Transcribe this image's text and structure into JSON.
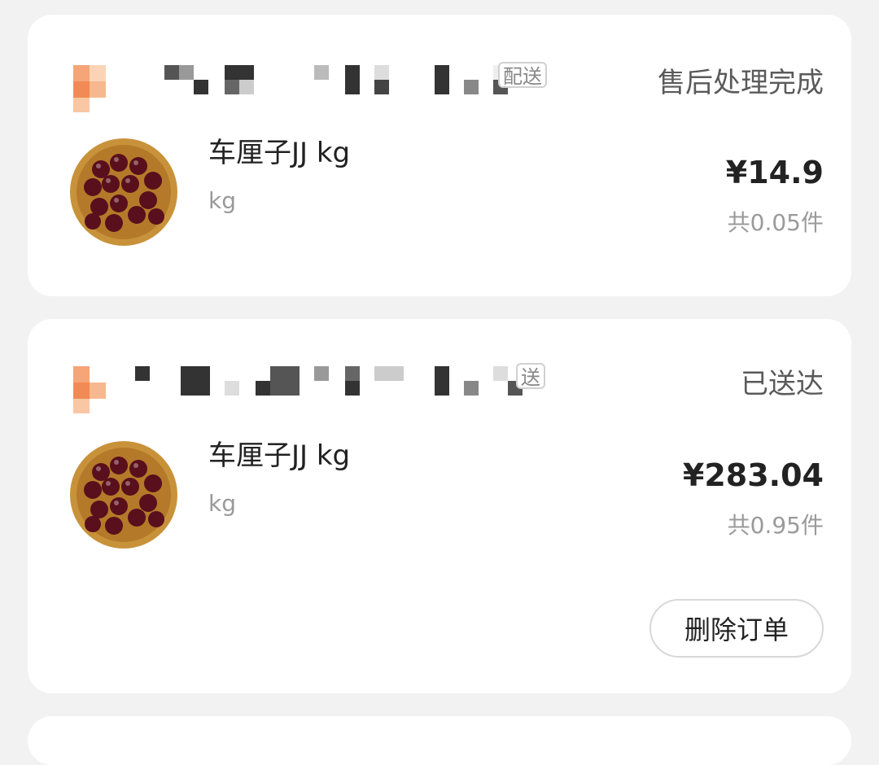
{
  "colors": {
    "background": "#f2f2f2",
    "card": "#ffffff",
    "logo_orange": "#f28a55",
    "status_text": "#5a5a5a",
    "muted_text": "#9a9a9a"
  },
  "orders": [
    {
      "store_logo": "orange-store-logo",
      "delivery_tag": "配送",
      "status": "售后处理完成",
      "item": {
        "image": "cherries-in-wooden-bowl",
        "title": "车厘子JJ kg",
        "spec": "kg",
        "price": "¥14.9",
        "quantity": "共0.05件"
      }
    },
    {
      "store_logo": "orange-store-logo",
      "delivery_tag": "送",
      "status": "已送达",
      "item": {
        "image": "cherries-in-wooden-bowl",
        "title": "车厘子JJ kg",
        "spec": "kg",
        "price": "¥283.04",
        "quantity": "共0.95件"
      },
      "action_button": "删除订单"
    }
  ]
}
